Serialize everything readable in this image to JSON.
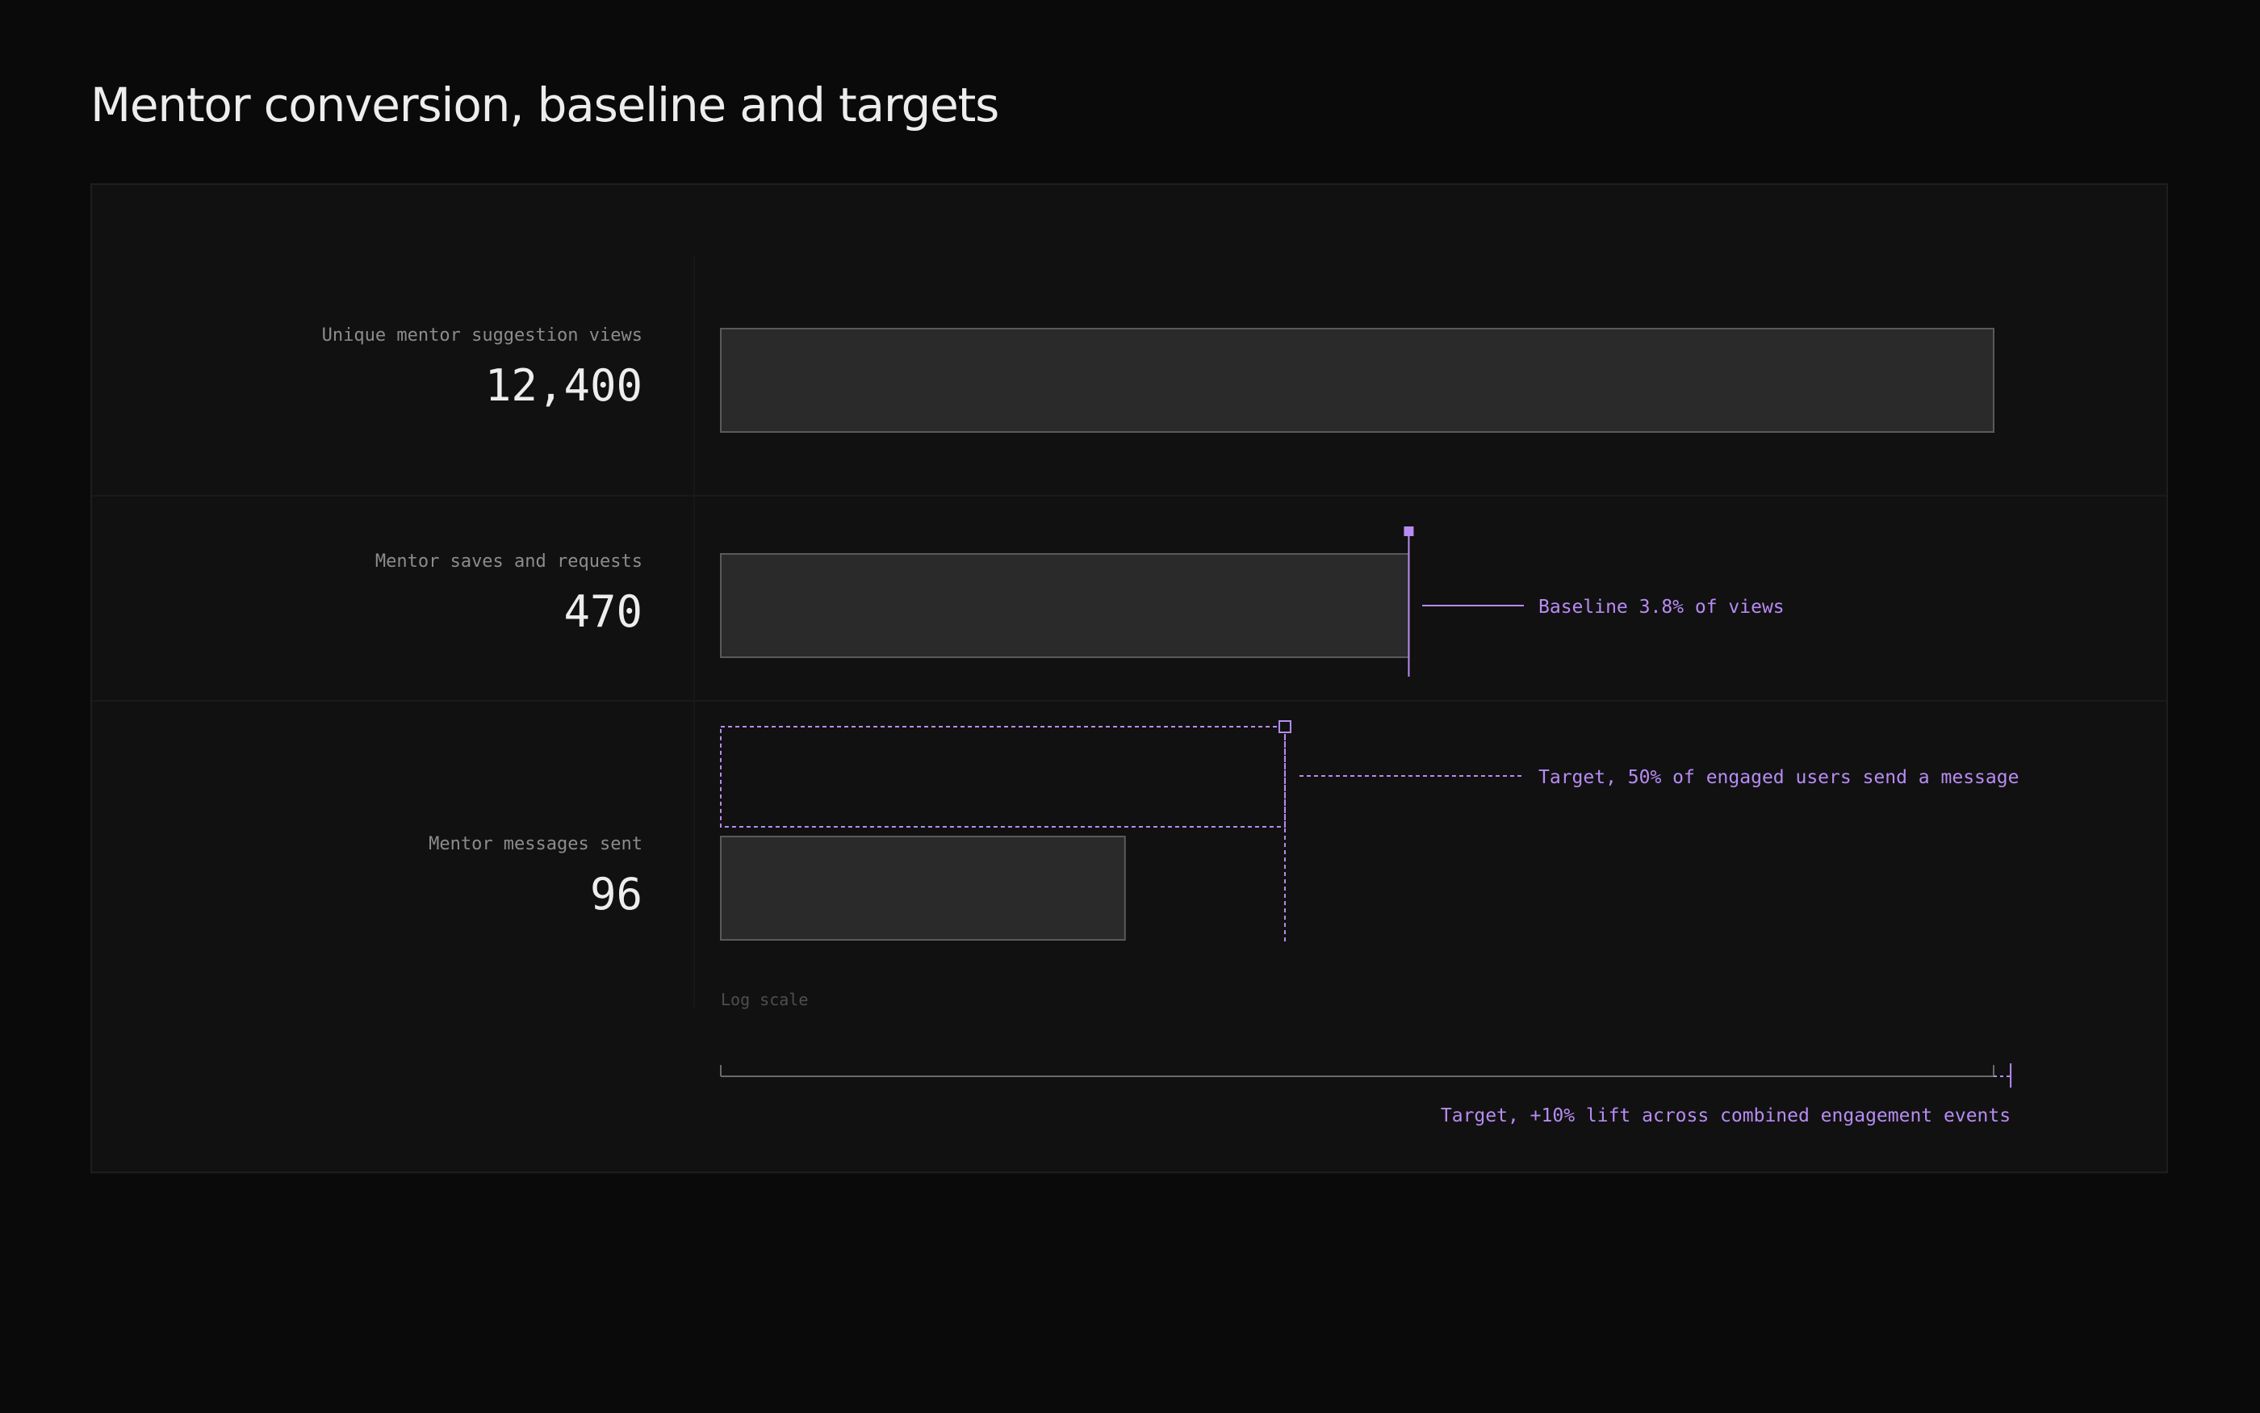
{
  "title": "Mentor conversion, baseline and targets",
  "colors": {
    "background": "#0a0a0a",
    "panel": "#111111",
    "bar_fill": "#2a2a2a",
    "bar_stroke": "#5a5a5a",
    "accent": "#b78cf2",
    "label": "#8c8c8c",
    "value": "#ededed"
  },
  "chart_data": {
    "type": "bar",
    "orientation": "horizontal",
    "scale": "log",
    "scale_label": "Log scale",
    "categories": [
      "Unique mentor suggestion views",
      "Mentor saves and requests",
      "Mentor messages sent"
    ],
    "values": [
      12400,
      470,
      96
    ],
    "value_labels": [
      "12,400",
      "470",
      "96"
    ],
    "annotations": {
      "baseline": {
        "category": "Mentor saves and requests",
        "value": 470,
        "label": "Baseline 3.8% of views"
      },
      "message_target": {
        "category": "Mentor messages sent",
        "value": 235,
        "label": "Target, 50% of engaged users send a message"
      },
      "engagement_target": {
        "value": 13640,
        "label": "Target, +10% lift across combined engagement events"
      }
    }
  }
}
